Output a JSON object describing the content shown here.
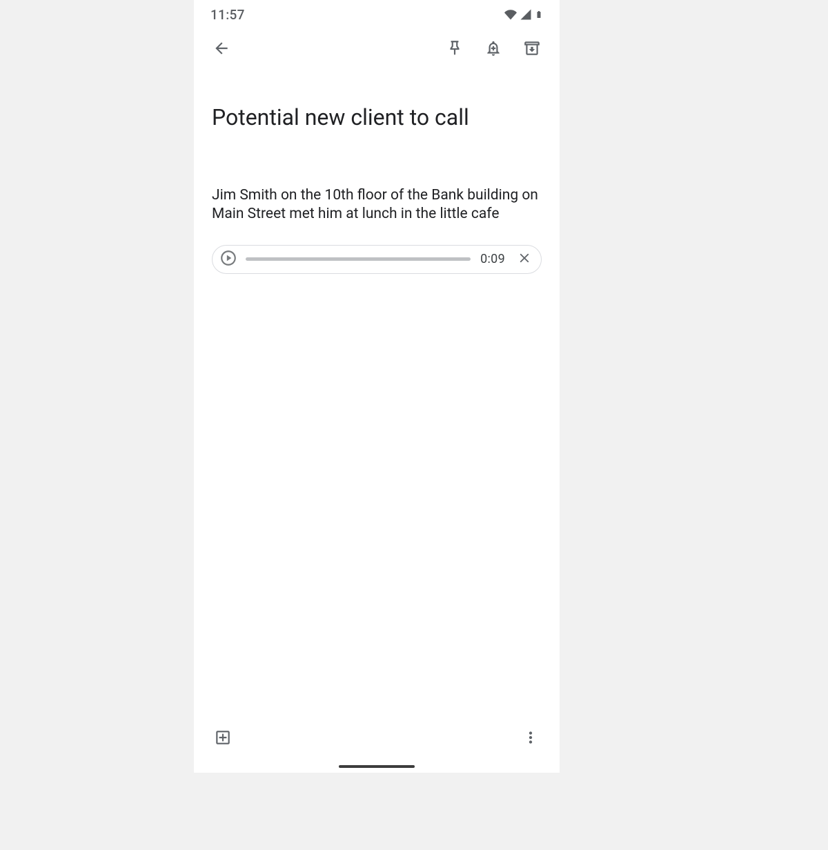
{
  "statusbar": {
    "time": "11:57"
  },
  "note": {
    "title": "Potential new client to call",
    "body": "Jim Smith on the 10th floor of the Bank building on Main Street met him at lunch in the little cafe"
  },
  "audio": {
    "duration_label": "0:09"
  }
}
